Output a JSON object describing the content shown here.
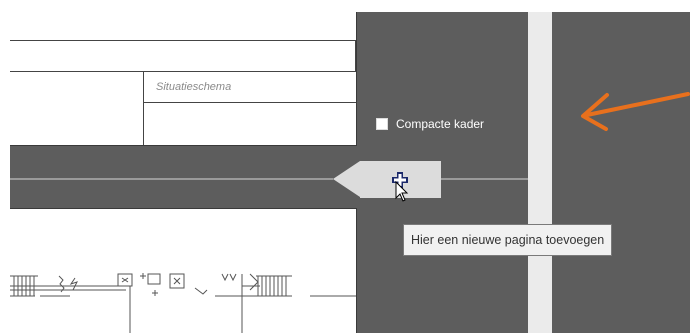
{
  "canvas": {
    "background_color": "#5d5d5d",
    "page_color": "#ffffff",
    "accent_color": "#e8701d"
  },
  "title_block": {
    "cell_label": "Situatieschema"
  },
  "options": {
    "compact_frame": {
      "label": "Compacte kader",
      "checked": false
    }
  },
  "add_page": {
    "icon": "plus-icon",
    "tooltip": "Hier een nieuwe pagina toevoegen"
  }
}
